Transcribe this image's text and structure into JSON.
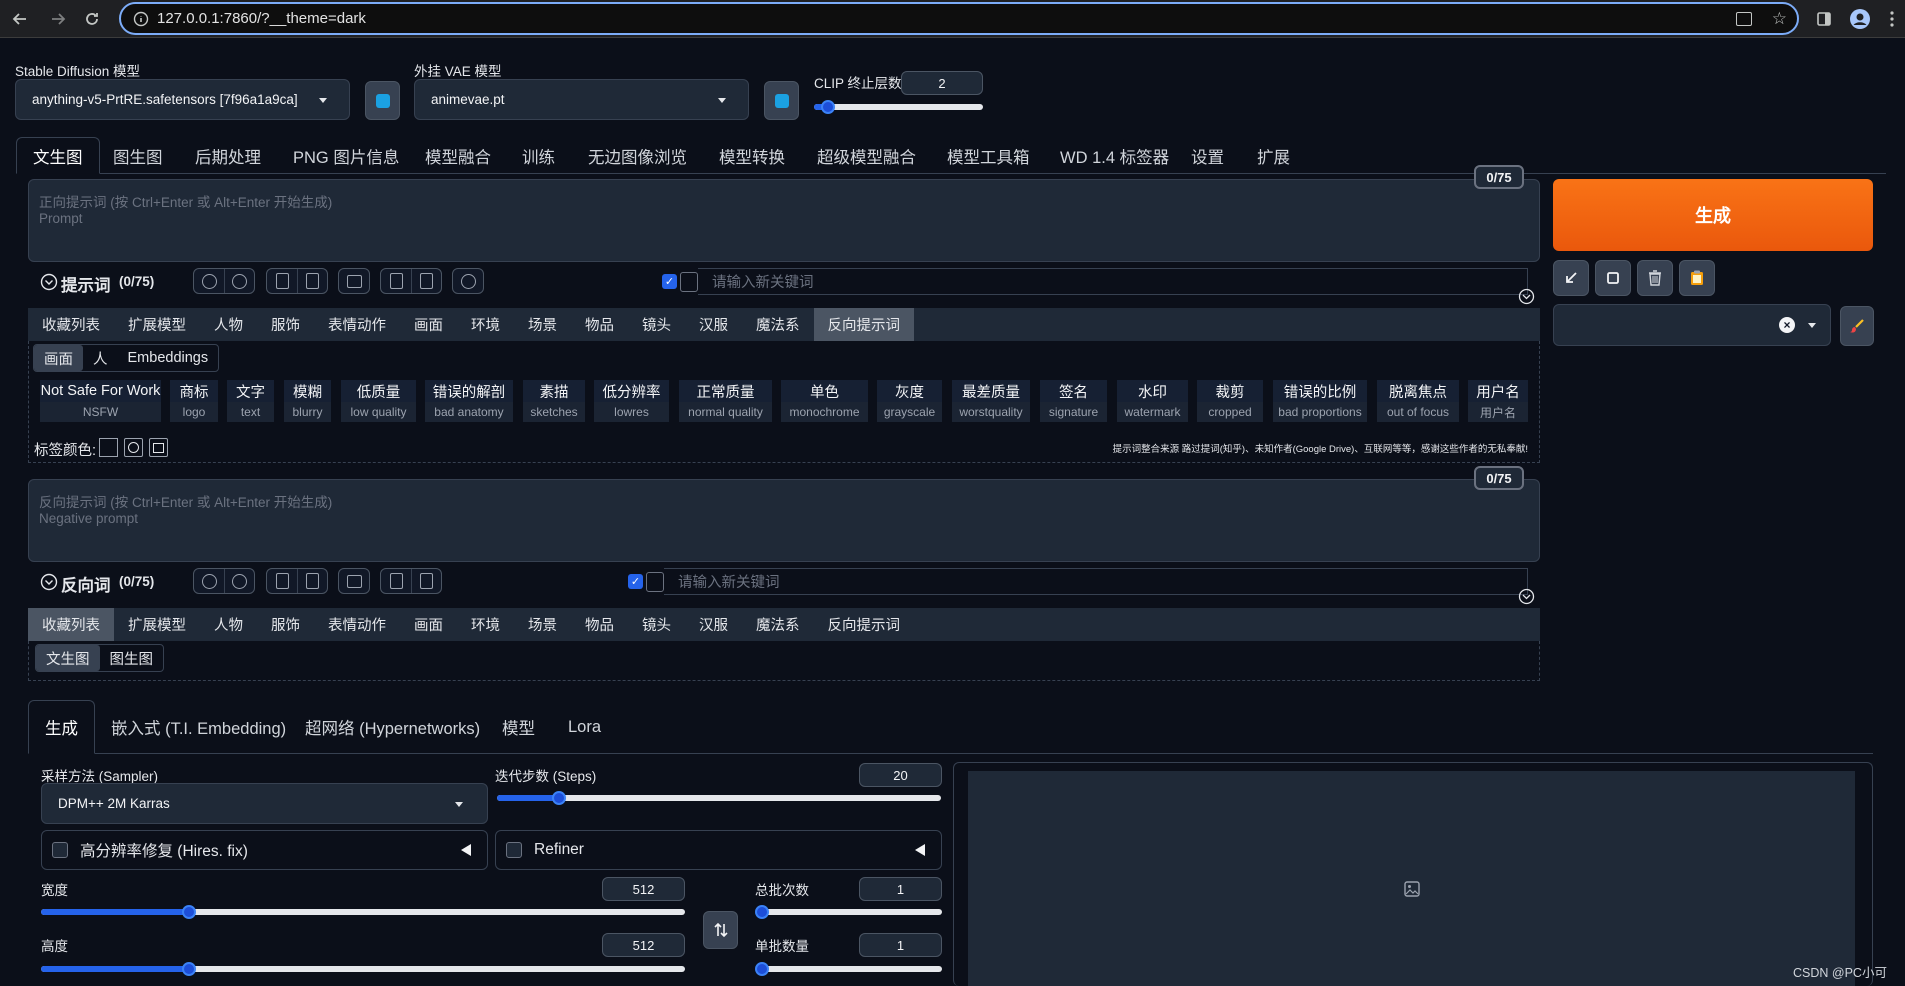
{
  "browser": {
    "url": "127.0.0.1:7860/?__theme=dark"
  },
  "top": {
    "sd_model_label": "Stable Diffusion 模型",
    "sd_model_value": "anything-v5-PrtRE.safetensors [7f96a1a9ca]",
    "vae_label": "外挂 VAE 模型",
    "vae_value": "animevae.pt",
    "clip_label": "CLIP 终止层数",
    "clip_value": "2",
    "clip_fraction": 0.08
  },
  "main_tabs": [
    "文生图",
    "图生图",
    "后期处理",
    "PNG 图片信息",
    "模型融合",
    "训练",
    "无边图像浏览",
    "模型转换",
    "超级模型融合",
    "模型工具箱",
    "WD 1.4 标签器",
    "设置",
    "扩展"
  ],
  "prompt": {
    "counter": "0/75",
    "placeholder_line1": "正向提示词 (按 Ctrl+Enter 或 Alt+Enter 开始生成)",
    "placeholder_line2": "Prompt",
    "section_title": "提示词",
    "section_count": "(0/75)",
    "keyword_placeholder": "请输入新关键词"
  },
  "category_tabs": [
    "收藏列表",
    "扩展模型",
    "人物",
    "服饰",
    "表情动作",
    "画面",
    "环境",
    "场景",
    "物品",
    "镜头",
    "汉服",
    "魔法系",
    "反向提示词"
  ],
  "neg_subtabs": [
    "画面",
    "人",
    "Embeddings"
  ],
  "neg_tags": [
    {
      "zh": "Not Safe For Work",
      "en": "NSFW"
    },
    {
      "zh": "商标",
      "en": "logo"
    },
    {
      "zh": "文字",
      "en": "text"
    },
    {
      "zh": "模糊",
      "en": "blurry"
    },
    {
      "zh": "低质量",
      "en": "low quality"
    },
    {
      "zh": "错误的解剖",
      "en": "bad anatomy"
    },
    {
      "zh": "素描",
      "en": "sketches"
    },
    {
      "zh": "低分辨率",
      "en": "lowres"
    },
    {
      "zh": "正常质量",
      "en": "normal quality"
    },
    {
      "zh": "单色",
      "en": "monochrome"
    },
    {
      "zh": "灰度",
      "en": "grayscale"
    },
    {
      "zh": "最差质量",
      "en": "worstquality"
    },
    {
      "zh": "签名",
      "en": "signature"
    },
    {
      "zh": "水印",
      "en": "watermark"
    },
    {
      "zh": "裁剪",
      "en": "cropped"
    },
    {
      "zh": "错误的比例",
      "en": "bad proportions"
    },
    {
      "zh": "脱离焦点",
      "en": "out of focus"
    },
    {
      "zh": "用户名",
      "en": "用户名"
    }
  ],
  "tag_color_label": "标签颜色:",
  "source_note": "提示词整合来源 路过提词(知乎)、未知作者(Google Drive)、互联网等等，感谢这些作者的无私奉献!",
  "negative": {
    "counter": "0/75",
    "placeholder_line1": "反向提示词 (按 Ctrl+Enter 或 Alt+Enter 开始生成)",
    "placeholder_line2": "Negative prompt",
    "section_title": "反向词",
    "section_count": "(0/75)",
    "keyword_placeholder": "请输入新关键词"
  },
  "fav_subtabs": [
    "文生图",
    "图生图"
  ],
  "right": {
    "generate": "生成"
  },
  "bottom_tabs": [
    "生成",
    "嵌入式 (T.I. Embedding)",
    "超网络 (Hypernetworks)",
    "模型",
    "Lora"
  ],
  "params": {
    "sampler_label": "采样方法 (Sampler)",
    "sampler_value": "DPM++ 2M Karras",
    "steps_label": "迭代步数 (Steps)",
    "steps_value": "20",
    "steps_fraction": 0.14,
    "hires_label": "高分辨率修复 (Hires. fix)",
    "refiner_label": "Refiner",
    "width_label": "宽度",
    "width_value": "512",
    "width_fraction": 0.23,
    "height_label": "高度",
    "height_value": "512",
    "height_fraction": 0.23,
    "batch_count_label": "总批次数",
    "batch_count_value": "1",
    "batch_count_fraction": 0.0,
    "batch_size_label": "单批数量",
    "batch_size_value": "1",
    "batch_size_fraction": 0.0
  },
  "watermark": "CSDN @PC小可"
}
